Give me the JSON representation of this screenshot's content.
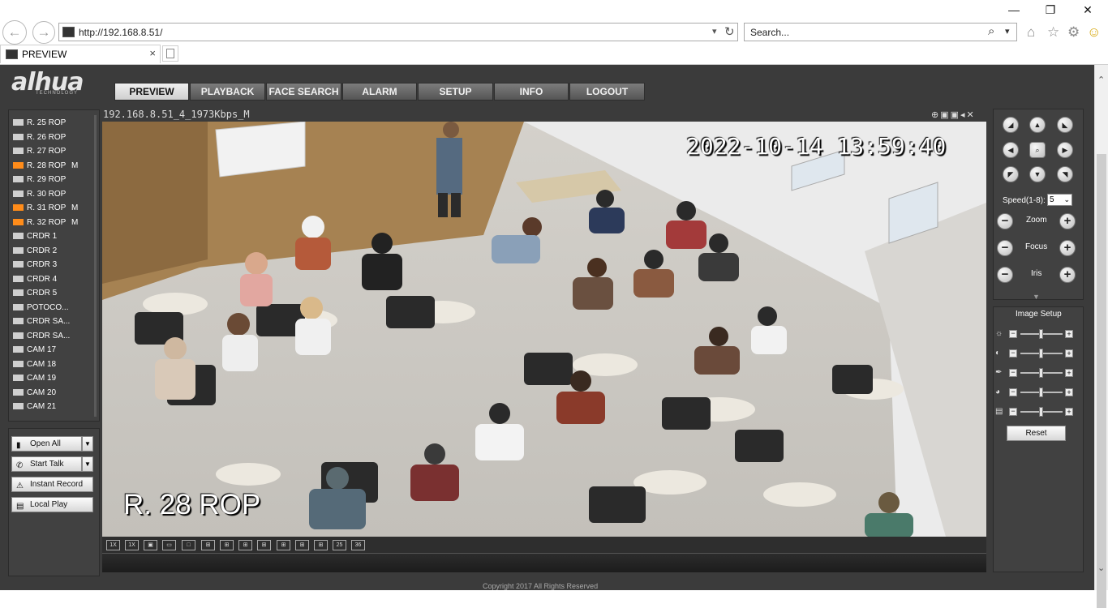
{
  "browser": {
    "url": "http://192.168.8.51/",
    "search_placeholder": "Search...",
    "tab_title": "PREVIEW",
    "back_icon": "←",
    "forward_icon": "→",
    "refresh_icon": "↻",
    "dropdown_icon": "▾",
    "minimize_icon": "—",
    "restore_icon": "❐",
    "close_icon": "✕",
    "home_icon": "⌂",
    "star_icon": "☆",
    "gear_icon": "⚙",
    "smiley_icon": "☺",
    "tab_close_icon": "×",
    "search_icon": "⌕"
  },
  "app": {
    "logo": "alhua",
    "logo_sub": "TECHNOLOGY",
    "nav": [
      "PREVIEW",
      "PLAYBACK",
      "FACE SEARCH",
      "ALARM",
      "SETUP",
      "INFO",
      "LOGOUT"
    ]
  },
  "cameras": [
    {
      "name": "R. 25 ROP",
      "active": false,
      "flag": ""
    },
    {
      "name": "R. 26 ROP",
      "active": false,
      "flag": ""
    },
    {
      "name": "R. 27 ROP",
      "active": false,
      "flag": ""
    },
    {
      "name": "R. 28 ROP",
      "active": true,
      "flag": "M"
    },
    {
      "name": "R. 29 ROP",
      "active": false,
      "flag": ""
    },
    {
      "name": "R. 30 ROP",
      "active": false,
      "flag": ""
    },
    {
      "name": "R. 31 ROP",
      "active": true,
      "flag": "M"
    },
    {
      "name": "R. 32 ROP",
      "active": true,
      "flag": "M"
    },
    {
      "name": "CRDR 1",
      "active": false,
      "flag": ""
    },
    {
      "name": "CRDR 2",
      "active": false,
      "flag": ""
    },
    {
      "name": "CRDR 3",
      "active": false,
      "flag": ""
    },
    {
      "name": "CRDR 4",
      "active": false,
      "flag": ""
    },
    {
      "name": "CRDR 5",
      "active": false,
      "flag": ""
    },
    {
      "name": "POTOCO...",
      "active": false,
      "flag": ""
    },
    {
      "name": "CRDR SA...",
      "active": false,
      "flag": ""
    },
    {
      "name": "CRDR SA...",
      "active": false,
      "flag": ""
    },
    {
      "name": "CAM 17",
      "active": false,
      "flag": ""
    },
    {
      "name": "CAM 18",
      "active": false,
      "flag": ""
    },
    {
      "name": "CAM 19",
      "active": false,
      "flag": ""
    },
    {
      "name": "CAM 20",
      "active": false,
      "flag": ""
    },
    {
      "name": "CAM 21",
      "active": false,
      "flag": ""
    }
  ],
  "controls": {
    "open_all": "Open All",
    "start_talk": "Start Talk",
    "instant_record": "Instant Record",
    "local_play": "Local Play",
    "dropdown_arrow": "▼"
  },
  "video": {
    "stream_info": "192.168.8.51_4_1973Kbps_M",
    "timestamp": "2022-10-14 13:59:40",
    "channel_name": "R. 28 ROP",
    "header_icons": "⊕▣▣◂✕"
  },
  "layouts": [
    "1X",
    "1X",
    "▣",
    "▭",
    "□",
    "⊞",
    "⊞",
    "⊞",
    "⊞",
    "⊞",
    "⊞",
    "⊞",
    "25",
    "36"
  ],
  "ptz": {
    "speed_label": "Speed(1-8):",
    "speed_value": "5",
    "zoom": "Zoom",
    "focus": "Focus",
    "iris": "Iris",
    "minus": "−",
    "plus": "+"
  },
  "image_setup": {
    "title": "Image Setup",
    "reset": "Reset",
    "sliders": [
      {
        "icon": "brightness-icon",
        "glyph": "☼",
        "level": 0.5
      },
      {
        "icon": "contrast-icon",
        "glyph": "◐",
        "level": 0.5
      },
      {
        "icon": "saturation-icon",
        "glyph": "✒",
        "level": 0.5
      },
      {
        "icon": "hue-icon",
        "glyph": "◕",
        "level": 0.5
      },
      {
        "icon": "sharpness-icon",
        "glyph": "▤",
        "level": 0.5
      }
    ]
  },
  "footer": "Copyright 2017 All Rights Reserved"
}
